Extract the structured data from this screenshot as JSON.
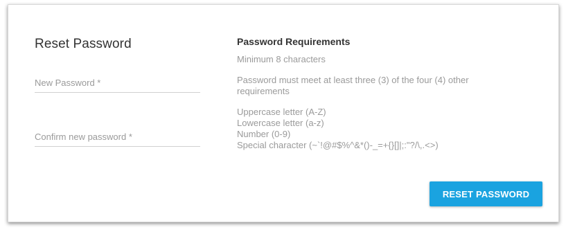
{
  "form": {
    "title": "Reset Password",
    "new_password_placeholder": "New Password *",
    "confirm_password_placeholder": "Confirm new password *"
  },
  "requirements": {
    "title": "Password Requirements",
    "minimum": "Minimum 8 characters",
    "three_of_four": "Password must meet at least three (3) of the four (4) other requirements",
    "items": [
      "Uppercase letter (A-Z)",
      "Lowercase letter (a-z)",
      "Number (0-9)",
      "Special character (~`!@#$%^&*()-_=+{}[]|;:\"?/\\,.<>)"
    ]
  },
  "actions": {
    "reset_label": "RESET PASSWORD"
  },
  "colors": {
    "accent": "#1aa3e0",
    "text_dark": "#333333",
    "text_muted": "#9a9a9a"
  }
}
